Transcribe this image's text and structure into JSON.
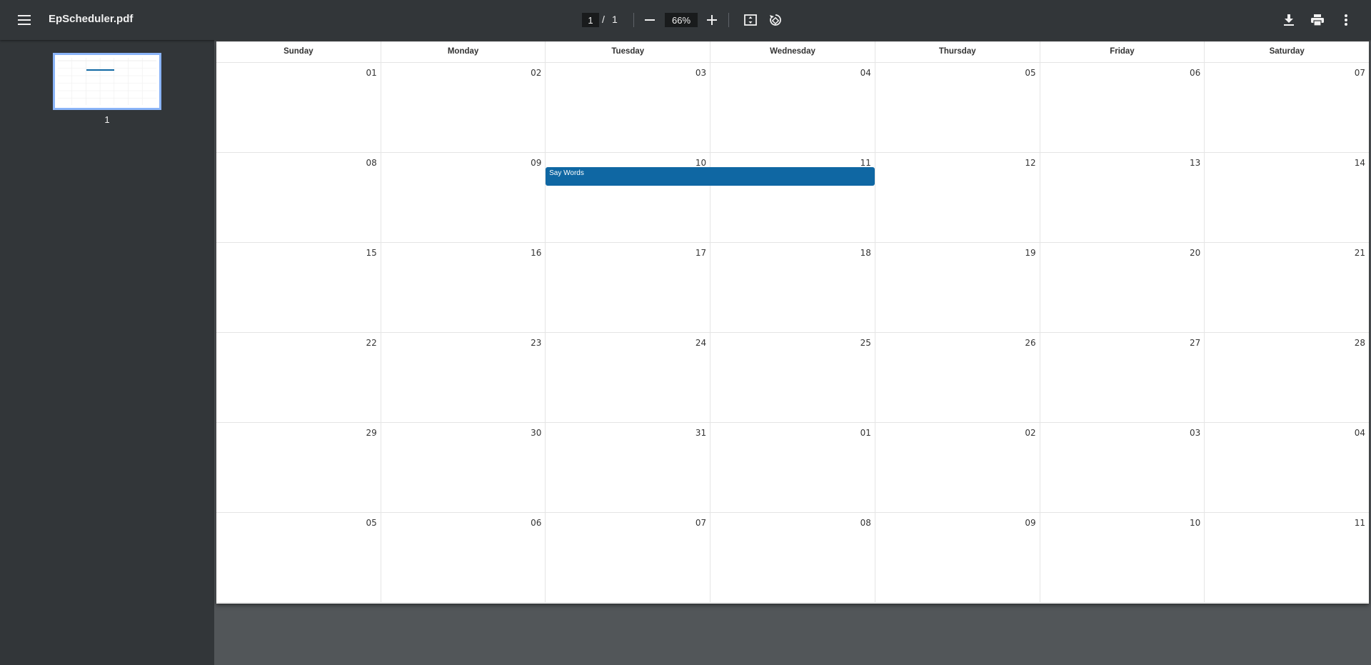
{
  "toolbar": {
    "title": "EpScheduler.pdf",
    "current_page": "1",
    "page_separator": "/",
    "total_pages": "1",
    "zoom": "66%"
  },
  "sidebar": {
    "thumbnail_label": "1"
  },
  "calendar": {
    "weekdays": [
      "Sunday",
      "Monday",
      "Tuesday",
      "Wednesday",
      "Thursday",
      "Friday",
      "Saturday"
    ],
    "weeks": [
      [
        "01",
        "02",
        "03",
        "04",
        "05",
        "06",
        "07"
      ],
      [
        "08",
        "09",
        "10",
        "11",
        "12",
        "13",
        "14"
      ],
      [
        "15",
        "16",
        "17",
        "18",
        "19",
        "20",
        "21"
      ],
      [
        "22",
        "23",
        "24",
        "25",
        "26",
        "27",
        "28"
      ],
      [
        "29",
        "30",
        "31",
        "01",
        "02",
        "03",
        "04"
      ],
      [
        "05",
        "06",
        "07",
        "08",
        "09",
        "10",
        "11"
      ]
    ],
    "event": {
      "title": "Say Words",
      "color": "#0f67a3"
    }
  },
  "colors": {
    "toolbar_bg": "#323639",
    "viewer_bg": "#525659",
    "thumbnail_border": "#8ab4f8"
  }
}
